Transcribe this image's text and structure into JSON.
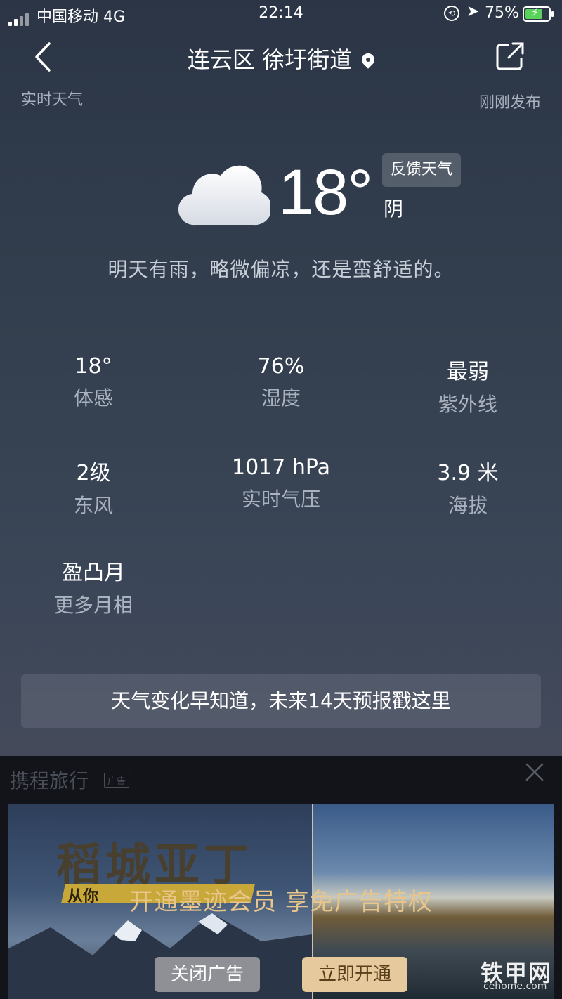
{
  "status_bar": {
    "carrier": "中国移动",
    "network": "4G",
    "time": "22:14",
    "battery": "75%"
  },
  "header": {
    "location": "连云区 徐圩街道",
    "left_caption": "实时天气",
    "right_caption": "刚刚发布"
  },
  "current": {
    "temperature": "18°",
    "condition": "阴",
    "feedback_label": "反馈天气",
    "summary": "明天有雨，略微偏凉，还是蛮舒适的。"
  },
  "stats": [
    {
      "value": "18°",
      "label": "体感"
    },
    {
      "value": "76%",
      "label": "湿度"
    },
    {
      "value": "最弱",
      "label": "紫外线"
    },
    {
      "value": "2级",
      "label": "东风"
    },
    {
      "value": "1017 hPa",
      "label": "实时气压"
    },
    {
      "value": "3.9 米",
      "label": "海拔"
    },
    {
      "value": "盈凸月",
      "label": "更多月相"
    }
  ],
  "forecast_link": "天气变化早知道，未来14天预报戳这里",
  "ad": {
    "advertiser": "携程旅行",
    "tag": "广告",
    "banner_text": "稻城亚丁",
    "banner_sub": "从你",
    "message": "开通墨迹会员  享免广告特权",
    "close_label": "关闭广告",
    "open_label": "立即开通"
  },
  "watermark": {
    "name": "铁甲网",
    "url": "cehome.com"
  },
  "colors": {
    "accent_gold": "#e6c99c",
    "ad_text": "#e8c58a"
  }
}
